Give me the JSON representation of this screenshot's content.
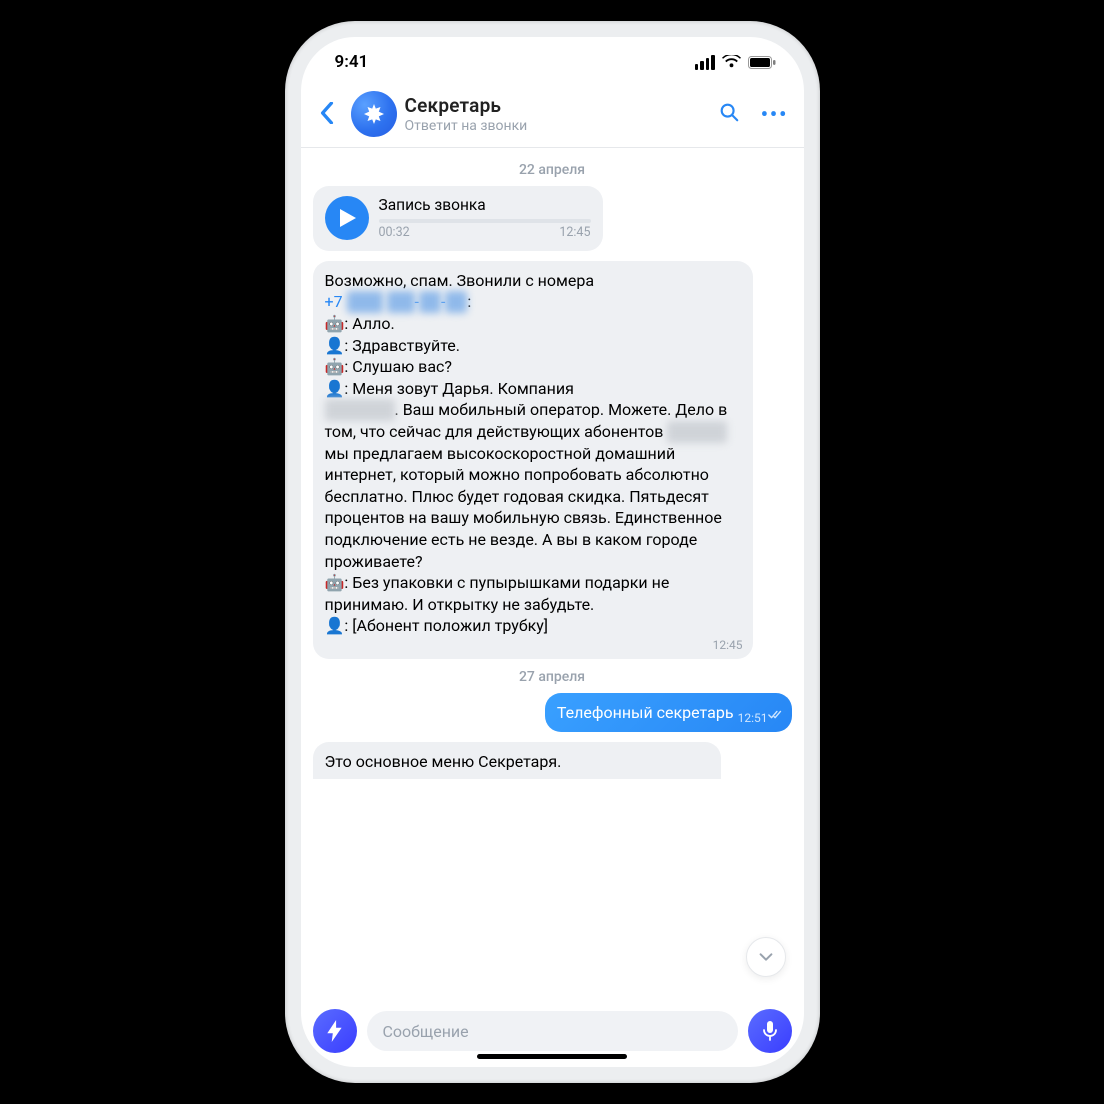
{
  "statusbar": {
    "time": "9:41"
  },
  "header": {
    "title": "Секретарь",
    "subtitle": "Ответит на звонки"
  },
  "date1": "22 апреля",
  "audio": {
    "title": "Запись звонка",
    "elapsed": "00:32",
    "timestamp": "12:45"
  },
  "transcript": {
    "lead": "Возможно, спам. Звонили с номера",
    "phone_prefix": "+7",
    "l1": "🤖: Алло.",
    "l2": "👤: Здравствуйте.",
    "l3": "🤖: Слушаю вас?",
    "l4a": "👤: Меня зовут Дарья. Компания",
    "l4b": ". Ваш мобильный оператор. Можете. Дело в том, что сейчас для действующих абонентов ",
    "l4c": " мы предлагаем высокоскоростной домашний интернет, который можно попробовать абсолютно бесплатно. Плюс будет годовая скидка. Пятьдесят процентов на вашу мобильную связь. Единственное подключение есть не везде. А вы в каком городе проживаете?",
    "l5": "🤖: Без упаковки с пупырышками подарки не принимаю. И открытку не забудьте.",
    "l6": "👤: [Абонент положил трубку]",
    "timestamp": "12:45"
  },
  "date2": "27 апреля",
  "outgoing": {
    "text": "Телефонный секретарь",
    "timestamp": "12:51"
  },
  "partial": {
    "text": "Это основное меню Секретаря."
  },
  "input": {
    "placeholder": "Сообщение"
  }
}
